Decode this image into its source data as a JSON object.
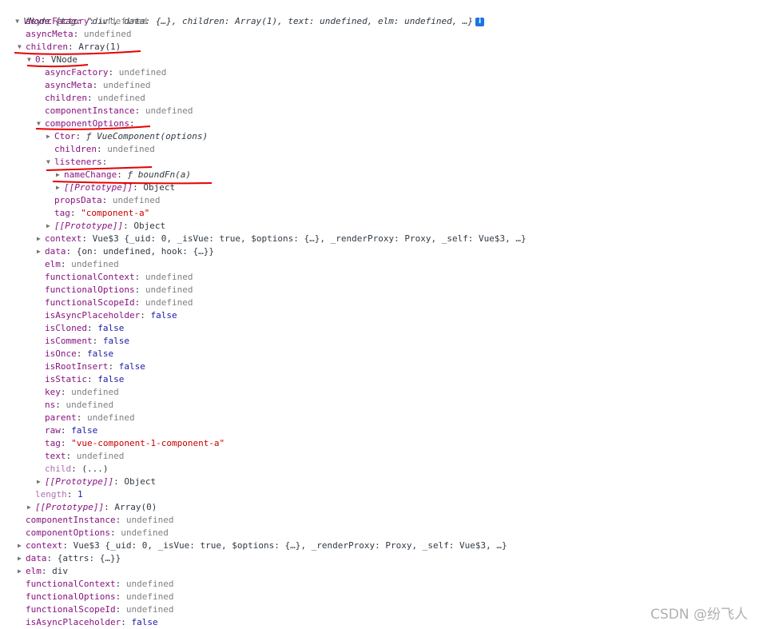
{
  "root": {
    "label": "VNode",
    "preview": "{tag: \"div\", data: {…}, children: Array(1), text: undefined, elm: undefined, …}",
    "info_icon": "i"
  },
  "rows": [
    {
      "d": 1,
      "arrow": "",
      "k": "asyncFactory",
      "v": "undefined",
      "t": "undef"
    },
    {
      "d": 1,
      "arrow": "",
      "k": "asyncMeta",
      "v": "undefined",
      "t": "undef"
    },
    {
      "d": 1,
      "arrow": "down",
      "k": "children",
      "v": "Array(1)",
      "t": "desc"
    },
    {
      "d": 2,
      "arrow": "down",
      "k": "0",
      "v": "VNode",
      "t": "desc"
    },
    {
      "d": 3,
      "arrow": "",
      "k": "asyncFactory",
      "v": "undefined",
      "t": "undef"
    },
    {
      "d": 3,
      "arrow": "",
      "k": "asyncMeta",
      "v": "undefined",
      "t": "undef"
    },
    {
      "d": 3,
      "arrow": "",
      "k": "children",
      "v": "undefined",
      "t": "undef"
    },
    {
      "d": 3,
      "arrow": "",
      "k": "componentInstance",
      "v": "undefined",
      "t": "undef"
    },
    {
      "d": 3,
      "arrow": "down",
      "k": "componentOptions",
      "v": "",
      "t": "desc"
    },
    {
      "d": 4,
      "arrow": "right",
      "k": "Ctor",
      "v": "ƒ VueComponent(options)",
      "t": "ital"
    },
    {
      "d": 4,
      "arrow": "",
      "k": "children",
      "v": "undefined",
      "t": "undef"
    },
    {
      "d": 4,
      "arrow": "down",
      "k": "listeners",
      "v": "",
      "t": "desc"
    },
    {
      "d": 5,
      "arrow": "right",
      "k": "nameChange",
      "v": "ƒ boundFn(a)",
      "t": "ital"
    },
    {
      "d": 5,
      "arrow": "right",
      "k": "[[Prototype]]",
      "v": "Object",
      "t": "desc",
      "proto": true
    },
    {
      "d": 4,
      "arrow": "",
      "k": "propsData",
      "v": "undefined",
      "t": "undef"
    },
    {
      "d": 4,
      "arrow": "",
      "k": "tag",
      "v": "\"component-a\"",
      "t": "str"
    },
    {
      "d": 4,
      "arrow": "right",
      "k": "[[Prototype]]",
      "v": "Object",
      "t": "desc",
      "proto": true
    },
    {
      "d": 3,
      "arrow": "right",
      "k": "context",
      "v": "Vue$3 {_uid: 0, _isVue: true, $options: {…}, _renderProxy: Proxy, _self: Vue$3, …}",
      "t": "desc"
    },
    {
      "d": 3,
      "arrow": "right",
      "k": "data",
      "v": "{on: undefined, hook: {…}}",
      "t": "desc"
    },
    {
      "d": 3,
      "arrow": "",
      "k": "elm",
      "v": "undefined",
      "t": "undef"
    },
    {
      "d": 3,
      "arrow": "",
      "k": "functionalContext",
      "v": "undefined",
      "t": "undef"
    },
    {
      "d": 3,
      "arrow": "",
      "k": "functionalOptions",
      "v": "undefined",
      "t": "undef"
    },
    {
      "d": 3,
      "arrow": "",
      "k": "functionalScopeId",
      "v": "undefined",
      "t": "undef"
    },
    {
      "d": 3,
      "arrow": "",
      "k": "isAsyncPlaceholder",
      "v": "false",
      "t": "bool"
    },
    {
      "d": 3,
      "arrow": "",
      "k": "isCloned",
      "v": "false",
      "t": "bool"
    },
    {
      "d": 3,
      "arrow": "",
      "k": "isComment",
      "v": "false",
      "t": "bool"
    },
    {
      "d": 3,
      "arrow": "",
      "k": "isOnce",
      "v": "false",
      "t": "bool"
    },
    {
      "d": 3,
      "arrow": "",
      "k": "isRootInsert",
      "v": "false",
      "t": "bool"
    },
    {
      "d": 3,
      "arrow": "",
      "k": "isStatic",
      "v": "false",
      "t": "bool"
    },
    {
      "d": 3,
      "arrow": "",
      "k": "key",
      "v": "undefined",
      "t": "undef"
    },
    {
      "d": 3,
      "arrow": "",
      "k": "ns",
      "v": "undefined",
      "t": "undef"
    },
    {
      "d": 3,
      "arrow": "",
      "k": "parent",
      "v": "undefined",
      "t": "undef"
    },
    {
      "d": 3,
      "arrow": "",
      "k": "raw",
      "v": "false",
      "t": "bool"
    },
    {
      "d": 3,
      "arrow": "",
      "k": "tag",
      "v": "\"vue-component-1-component-a\"",
      "t": "str"
    },
    {
      "d": 3,
      "arrow": "",
      "k": "text",
      "v": "undefined",
      "t": "undef"
    },
    {
      "d": 3,
      "arrow": "",
      "k": "child",
      "v": "(...)",
      "t": "desc",
      "dim": true
    },
    {
      "d": 3,
      "arrow": "right",
      "k": "[[Prototype]]",
      "v": "Object",
      "t": "desc",
      "proto": true
    },
    {
      "d": 2,
      "arrow": "",
      "k": "length",
      "v": "1",
      "t": "num",
      "dim": true
    },
    {
      "d": 2,
      "arrow": "right",
      "k": "[[Prototype]]",
      "v": "Array(0)",
      "t": "desc",
      "proto": true
    },
    {
      "d": 1,
      "arrow": "",
      "k": "componentInstance",
      "v": "undefined",
      "t": "undef"
    },
    {
      "d": 1,
      "arrow": "",
      "k": "componentOptions",
      "v": "undefined",
      "t": "undef"
    },
    {
      "d": 1,
      "arrow": "right",
      "k": "context",
      "v": "Vue$3 {_uid: 0, _isVue: true, $options: {…}, _renderProxy: Proxy, _self: Vue$3, …}",
      "t": "desc"
    },
    {
      "d": 1,
      "arrow": "right",
      "k": "data",
      "v": "{attrs: {…}}",
      "t": "desc"
    },
    {
      "d": 1,
      "arrow": "right",
      "k": "elm",
      "v": "div",
      "t": "desc"
    },
    {
      "d": 1,
      "arrow": "",
      "k": "functionalContext",
      "v": "undefined",
      "t": "undef"
    },
    {
      "d": 1,
      "arrow": "",
      "k": "functionalOptions",
      "v": "undefined",
      "t": "undef"
    },
    {
      "d": 1,
      "arrow": "",
      "k": "functionalScopeId",
      "v": "undefined",
      "t": "undef"
    },
    {
      "d": 1,
      "arrow": "",
      "k": "isAsyncPlaceholder",
      "v": "false",
      "t": "bool"
    }
  ],
  "watermark": "CSDN @纷飞人",
  "colors": {
    "key": "#881280",
    "undefined": "#808080",
    "boolean": "#1a1aa6",
    "string": "#c80000",
    "annotation": "#e60000"
  }
}
